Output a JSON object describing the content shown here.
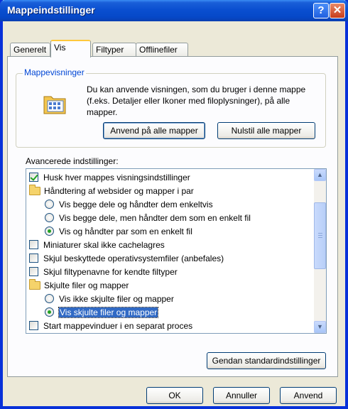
{
  "window": {
    "title": "Mappeindstillinger"
  },
  "titlebar": {
    "help_label": "?",
    "close_label": "✕"
  },
  "tabs": [
    {
      "label": "Generelt"
    },
    {
      "label": "Vis"
    },
    {
      "label": "Filtyper"
    },
    {
      "label": "Offlinefiler"
    }
  ],
  "folder_views": {
    "group_title": "Mappevisninger",
    "description": "Du kan anvende visningen, som du bruger i denne mappe (f.eks. Detaljer eller Ikoner med filoplysninger), på alle mapper.",
    "apply_all_label": "Anvend på alle mapper",
    "reset_all_label": "Nulstil alle mapper"
  },
  "advanced": {
    "label": "Avancerede indstillinger:",
    "items": [
      {
        "type": "checkbox",
        "checked": true,
        "label": "Husk hver mappes visningsindstillinger"
      },
      {
        "type": "folder",
        "label": "Håndtering af websider og mapper i par"
      },
      {
        "type": "radio",
        "checked": false,
        "label": "Vis begge dele og håndter dem enkeltvis"
      },
      {
        "type": "radio",
        "checked": false,
        "label": "Vis begge dele, men håndter dem som en enkelt fil"
      },
      {
        "type": "radio",
        "checked": true,
        "label": "Vis og håndter par som en enkelt fil"
      },
      {
        "type": "checkbox",
        "checked": false,
        "label": "Miniaturer skal ikke cachelagres"
      },
      {
        "type": "checkbox",
        "checked": false,
        "label": "Skjul beskyttede operativsystemfiler (anbefales)"
      },
      {
        "type": "checkbox",
        "checked": false,
        "label": "Skjul filtypenavne for kendte filtyper"
      },
      {
        "type": "folder",
        "label": "Skjulte filer og mapper"
      },
      {
        "type": "radio",
        "checked": false,
        "label": "Vis ikke skjulte filer og mapper"
      },
      {
        "type": "radio",
        "checked": true,
        "selected": true,
        "label": "Vis skjulte filer og mapper"
      },
      {
        "type": "checkbox",
        "checked": false,
        "label": "Start mappevinduer i en separat proces"
      }
    ]
  },
  "restore_defaults_label": "Gendan standardindstillinger",
  "footer": {
    "ok_label": "OK",
    "cancel_label": "Annuller",
    "apply_label": "Anvend"
  },
  "scrollbar": {
    "up_icon": "▲",
    "down_icon": "▼"
  },
  "colors": {
    "title_blue": "#0a4fd0",
    "group_title": "#0046d5",
    "selection": "#316ac5",
    "check_green": "#21a121"
  }
}
